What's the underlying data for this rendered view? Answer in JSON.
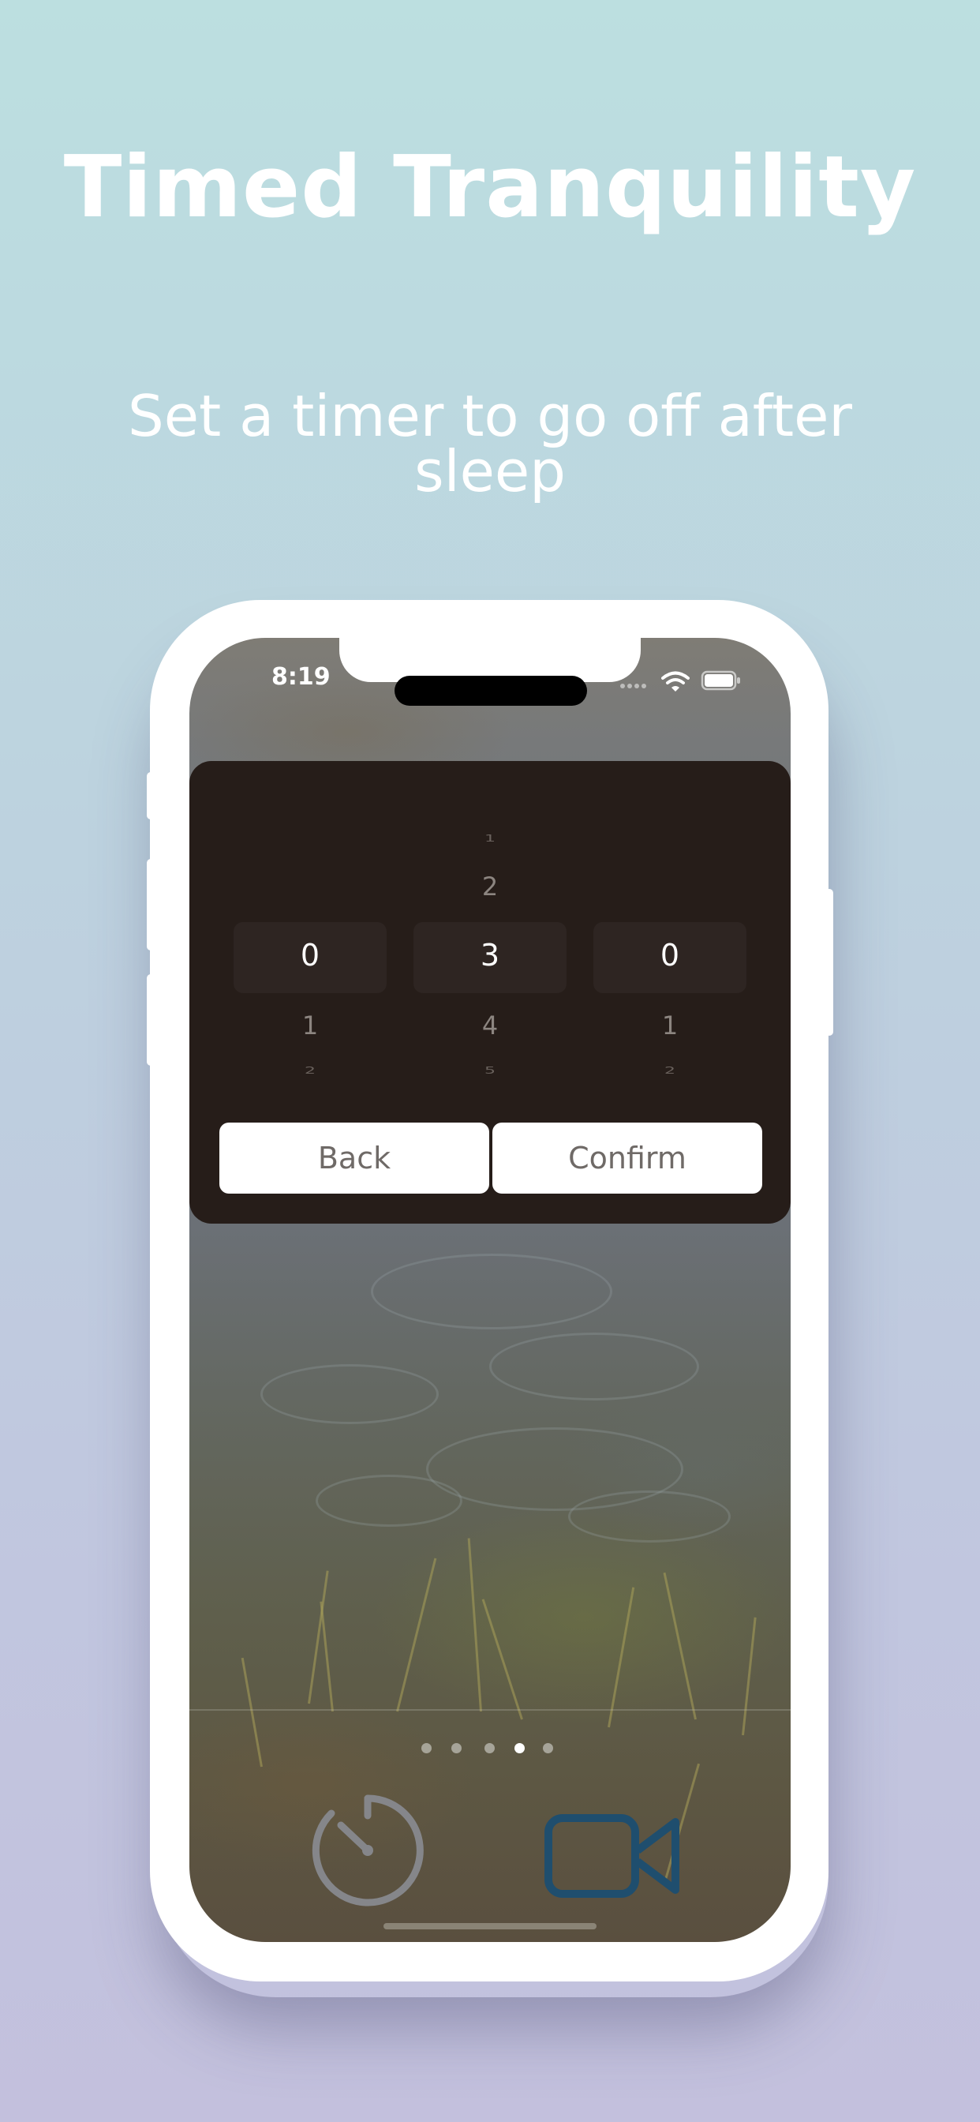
{
  "promo": {
    "title": "Timed Tranquility",
    "subtitle": "Set a timer to go off after sleep"
  },
  "status_bar": {
    "time": "8:19",
    "wifi_icon": "wifi-icon",
    "battery_icon": "battery-icon"
  },
  "picker": {
    "columns": [
      {
        "above2": "",
        "above1": "",
        "selected": "0",
        "below1": "1",
        "below2": "2"
      },
      {
        "above2": "1",
        "above1": "2",
        "selected": "3",
        "below1": "4",
        "below2": "5"
      },
      {
        "above2": "",
        "above1": "",
        "selected": "0",
        "below1": "1",
        "below2": "2"
      }
    ]
  },
  "buttons": {
    "back": "Back",
    "confirm": "Confirm"
  },
  "pager": {
    "count": 5,
    "active_index": 3
  },
  "bottom_bar": {
    "timer_icon": "timer-icon",
    "video_icon": "video-camera-icon",
    "video_icon_color": "#1f4e6e"
  },
  "colors": {
    "card_background": "#261d19",
    "selected_row": "#2e2522"
  }
}
